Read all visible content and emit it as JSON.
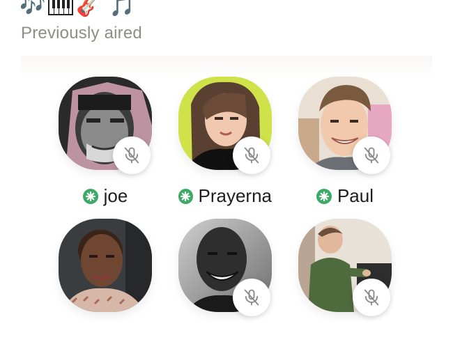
{
  "room": {
    "emojis": [
      "🎶",
      "🎸",
      "🎵"
    ],
    "status": "Previously aired"
  },
  "speakers": [
    {
      "name": "joe",
      "is_moderator": true,
      "muted": true
    },
    {
      "name": "Prayerna",
      "is_moderator": true,
      "muted": true
    },
    {
      "name": "Paul",
      "is_moderator": true,
      "muted": true
    },
    {
      "name": "",
      "is_moderator": false,
      "muted": false
    },
    {
      "name": "",
      "is_moderator": false,
      "muted": true
    },
    {
      "name": "",
      "is_moderator": false,
      "muted": true
    }
  ],
  "colors": {
    "moderator_badge": "#3aaa65",
    "status_text": "#8a8f86",
    "background": "#ffffff"
  }
}
